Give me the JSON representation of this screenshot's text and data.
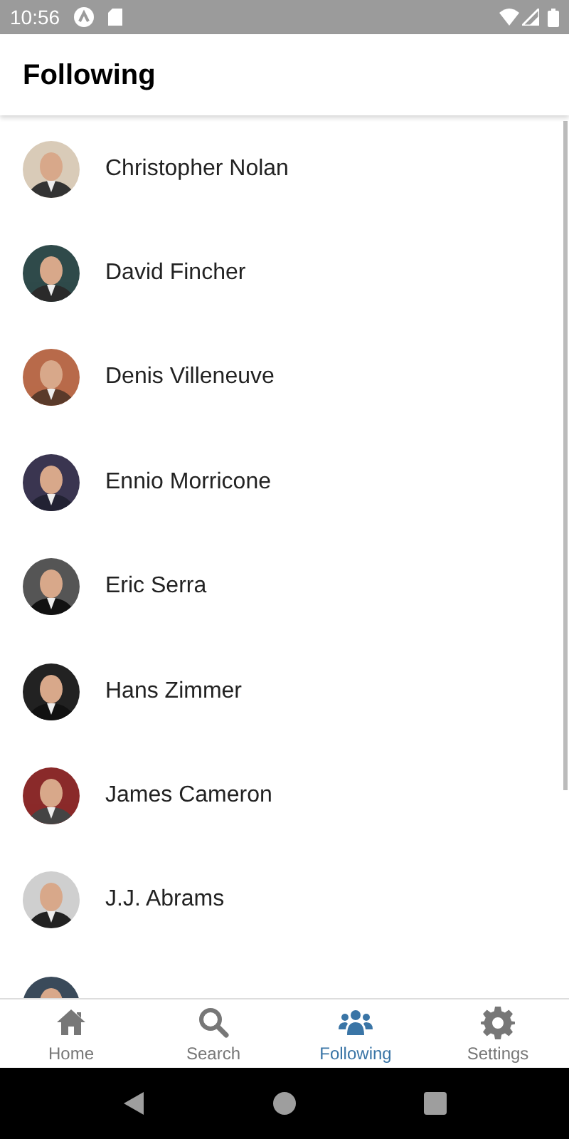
{
  "status_bar": {
    "time": "10:56"
  },
  "header": {
    "title": "Following"
  },
  "people": [
    {
      "name": "Christopher Nolan"
    },
    {
      "name": "David Fincher"
    },
    {
      "name": "Denis Villeneuve"
    },
    {
      "name": "Ennio Morricone"
    },
    {
      "name": "Eric Serra"
    },
    {
      "name": "Hans Zimmer"
    },
    {
      "name": "James Cameron"
    },
    {
      "name": "J.J. Abrams"
    },
    {
      "kind": "picture"
    }
  ],
  "tabs": [
    {
      "label": "Home",
      "kind": "home",
      "selected": false
    },
    {
      "label": "Search",
      "kind": "search",
      "selected": false
    },
    {
      "label": "Following",
      "kind": "people",
      "selected": true
    },
    {
      "label": "Settings",
      "kind": "settings",
      "selected": false
    }
  ]
}
